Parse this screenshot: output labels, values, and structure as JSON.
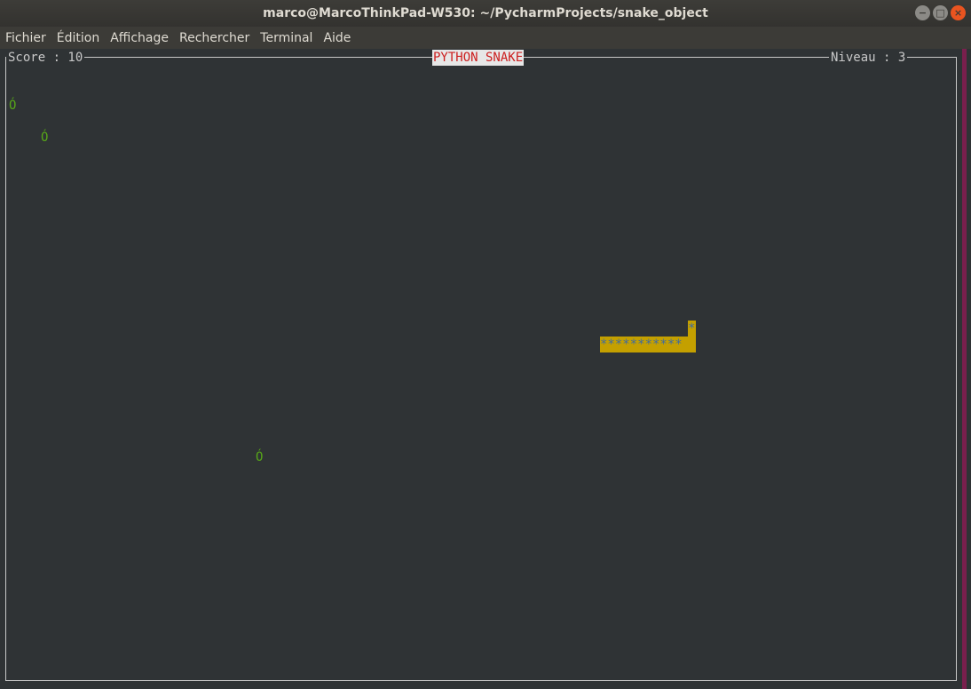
{
  "window": {
    "title": "marco@MarcoThinkPad-W530: ~/PycharmProjects/snake_object",
    "controls": {
      "minimize": "−",
      "maximize": "□",
      "close": "×"
    }
  },
  "menu": {
    "items": [
      "Fichier",
      "Édition",
      "Affichage",
      "Rechercher",
      "Terminal",
      "Aide"
    ]
  },
  "game": {
    "score_label": "Score : 10",
    "title": "PYTHON SNAKE",
    "level_label": "Niveau : 3",
    "apple_glyph": "Ó",
    "snake_head": "*",
    "snake_body": "***********",
    "colors": {
      "apple": "#57a718",
      "snake_bg": "#c4a000",
      "snake_fg": "#3f6ba0",
      "title_fg": "#cc1f1f",
      "title_bg": "#e7e7e7"
    }
  }
}
